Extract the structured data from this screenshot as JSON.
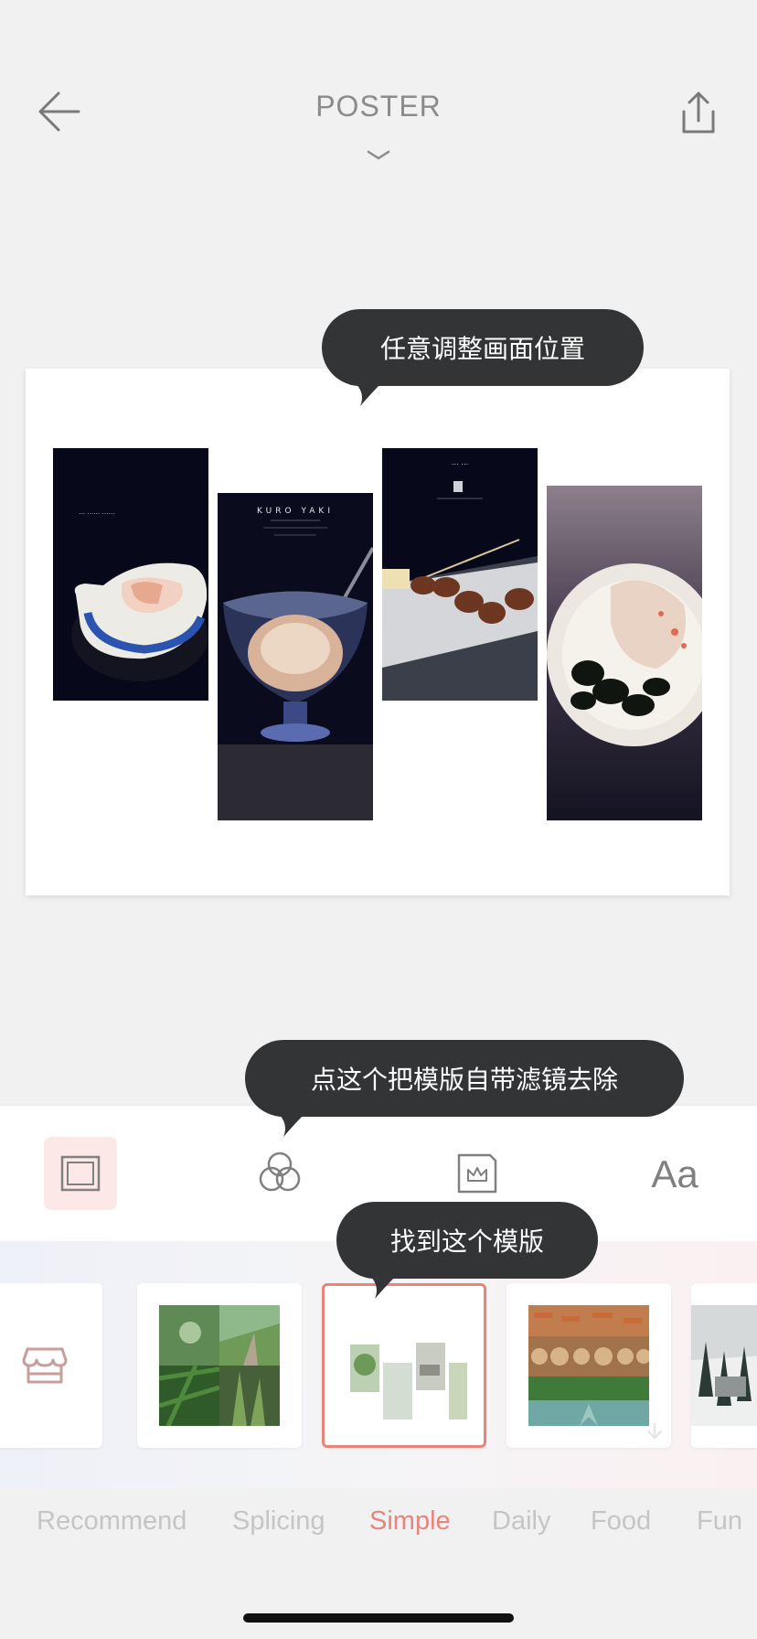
{
  "header": {
    "title": "POSTER",
    "back_icon": "arrow-left-icon",
    "share_icon": "share-icon",
    "dropdown_icon": "chevron-down-icon"
  },
  "canvas": {
    "photos": [
      {
        "text": "…  …… ……"
      },
      {
        "title": "KURO YAKI"
      },
      {
        "text": "…  …"
      },
      {
        "text": ""
      }
    ]
  },
  "tooltips": {
    "reposition": "任意调整画面位置",
    "remove_filter": "点这个把模版自带滤镜去除",
    "find_template": "找到这个模版"
  },
  "toolbar": {
    "tools": [
      {
        "name": "layout",
        "icon": "layout-icon",
        "active": true
      },
      {
        "name": "filter",
        "icon": "filter-icon",
        "active": false
      },
      {
        "name": "sticker",
        "icon": "sticker-icon",
        "active": false
      },
      {
        "name": "text",
        "icon": "text-icon",
        "label": "Aa",
        "active": false
      }
    ]
  },
  "templates": {
    "items": [
      {
        "type": "store",
        "icon": "store-icon"
      },
      {
        "type": "template",
        "theme": "green-nature",
        "downloaded": false
      },
      {
        "type": "template",
        "theme": "simple-white",
        "selected": true
      },
      {
        "type": "template",
        "theme": "wood-cactus",
        "downloaded": false
      },
      {
        "type": "template",
        "theme": "winter-forest"
      }
    ]
  },
  "tabs": {
    "items": [
      "Recommend",
      "Splicing",
      "Simple",
      "Daily",
      "Food",
      "Fun"
    ],
    "active_index": 2
  },
  "colors": {
    "accent": "#e8857a",
    "tooltip_bg": "#333436",
    "background": "#f1f1f2"
  }
}
